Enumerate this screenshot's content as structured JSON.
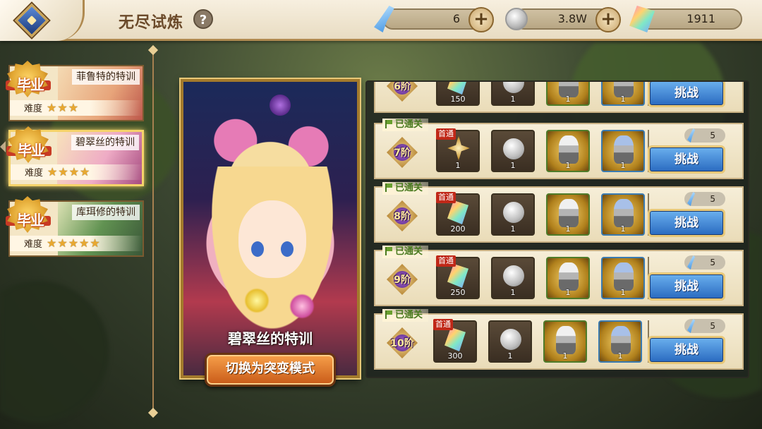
{
  "header": {
    "title": "无尽试炼",
    "help_icon": "?",
    "currencies": {
      "stamina": "6",
      "coins": "3.8W",
      "gems": "1911"
    }
  },
  "trials": [
    {
      "name": "菲鲁特的特训",
      "badge": "毕业",
      "difficulty_label": "难度",
      "stars": "★★★",
      "selected": false
    },
    {
      "name": "碧翠丝的特训",
      "badge": "毕业",
      "difficulty_label": "难度",
      "stars": "★★★★",
      "selected": true
    },
    {
      "name": "库珥修的特训",
      "badge": "毕业",
      "difficulty_label": "难度",
      "stars": "★★★★★",
      "selected": false
    }
  ],
  "card": {
    "title": "碧翠丝的特训",
    "mode_button": "切换为突变模式"
  },
  "stages": [
    {
      "level": "6阶",
      "cleared": "",
      "first_clear": "",
      "reward_gem_qty": "150",
      "reward_coin_qty": "1",
      "reward_a_qty": "1",
      "reward_b_qty": "1",
      "cost": "",
      "button": "挑战",
      "first_item": "gem"
    },
    {
      "level": "7阶",
      "cleared": "已通关",
      "first_clear": "首通",
      "reward_gem_qty": "1",
      "reward_coin_qty": "1",
      "reward_a_qty": "1",
      "reward_b_qty": "1",
      "cost": "5",
      "button": "挑战",
      "first_item": "compass"
    },
    {
      "level": "8阶",
      "cleared": "已通关",
      "first_clear": "首通",
      "reward_gem_qty": "200",
      "reward_coin_qty": "1",
      "reward_a_qty": "1",
      "reward_b_qty": "1",
      "cost": "5",
      "button": "挑战",
      "first_item": "gem"
    },
    {
      "level": "9阶",
      "cleared": "已通关",
      "first_clear": "首通",
      "reward_gem_qty": "250",
      "reward_coin_qty": "1",
      "reward_a_qty": "1",
      "reward_b_qty": "1",
      "cost": "5",
      "button": "挑战",
      "first_item": "gem"
    },
    {
      "level": "10阶",
      "cleared": "已通关",
      "first_clear": "首通",
      "reward_gem_qty": "300",
      "reward_coin_qty": "1",
      "reward_a_qty": "1",
      "reward_b_qty": "1",
      "cost": "5",
      "button": "挑战",
      "first_item": "gem"
    }
  ],
  "colors": {
    "accent_gold": "#e8c878",
    "challenge_blue": "#2a6ac0",
    "mode_orange": "#c85a18",
    "cleared_green": "#4a7a20"
  }
}
